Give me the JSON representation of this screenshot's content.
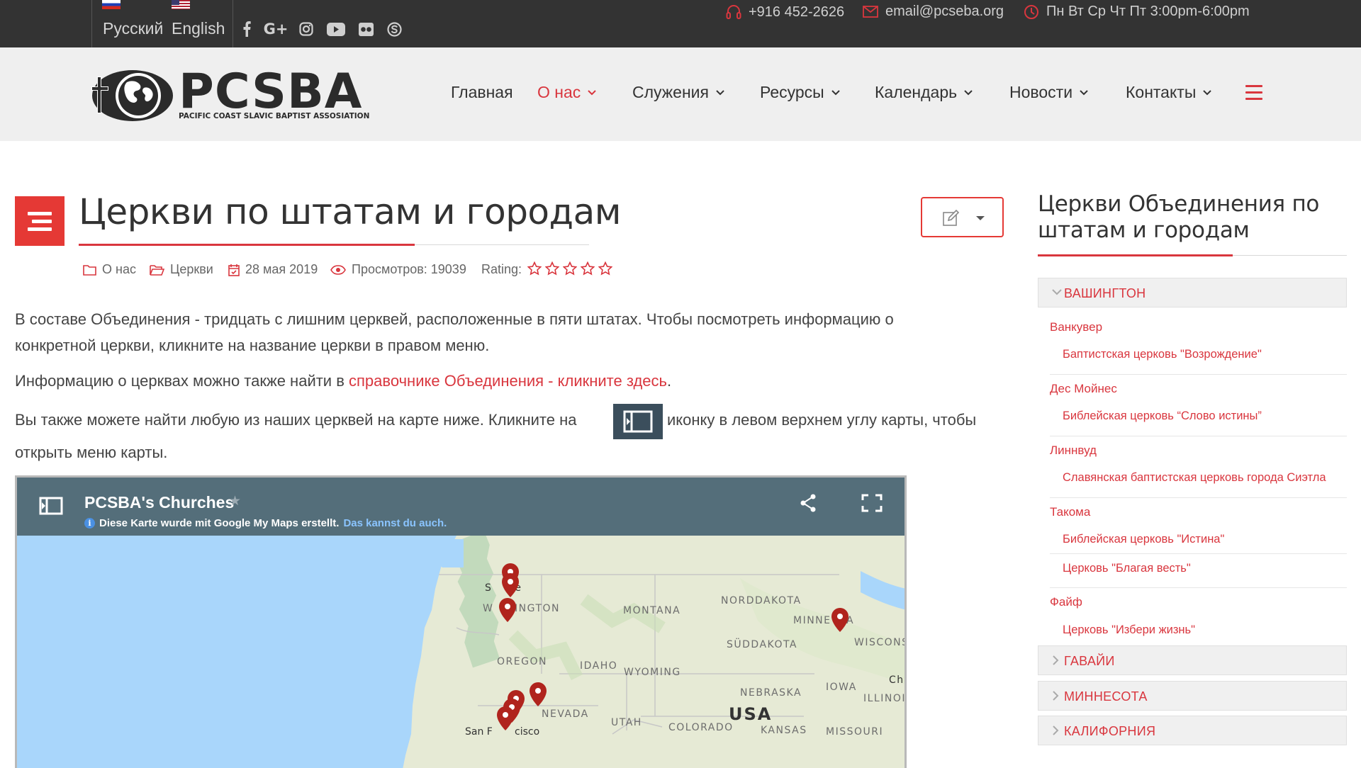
{
  "topbar": {
    "languages": [
      {
        "label": "Русский",
        "flag": "flag-ru-icon"
      },
      {
        "label": "English",
        "flag": "flag-us-icon"
      }
    ],
    "social": [
      "facebook-icon",
      "google-plus-icon",
      "instagram-icon",
      "youtube-icon",
      "flickr-icon",
      "skype-icon"
    ],
    "phone": "+916 452-2626",
    "email": "email@pcseba.org",
    "hours": "Пн Вт Ср Чт Пт 3:00pm-6:00pm"
  },
  "logo": {
    "title": "PCSBA",
    "subtitle": "PACIFIC COAST SLAVIC BAPTIST ASSOSIATION"
  },
  "nav": {
    "items": [
      {
        "label": "Главная"
      },
      {
        "label": "О нас"
      },
      {
        "label": "Служения"
      },
      {
        "label": "Ресурсы"
      },
      {
        "label": "Календарь"
      },
      {
        "label": "Новости"
      },
      {
        "label": "Контакты"
      }
    ],
    "active_index": 1
  },
  "article": {
    "title": "Церкви по штатам и городам",
    "meta": {
      "category": "О нас",
      "subcategory": "Церкви",
      "date": "28 мая 2019",
      "views": "Просмотров: 19039",
      "rating_label": "Rating:",
      "rating_stars": 0,
      "rating_max": 5
    },
    "p1_line1": "В составе Объединения - тридцать с лишним церквей, расположенные в пяти штатах. Чтобы посмотреть информацию о",
    "p1_line2": "конкретной церкви, кликните на название церкви в правом меню.",
    "p2_text": "Информацию о церквах можно также найти в ",
    "p2_link": "справочнике Объединения - кликните здесь",
    "p2_end": ".",
    "p3_text": "Вы также можете найти любую из наших церквей на карте ниже. Кликните на",
    "p3_text_after": "иконку в левом верхнем углу карты, чтобы",
    "p3_line2": "открыть меню карты."
  },
  "map": {
    "title": "PCSBA's Churches",
    "notice": "Diese Karte wurde mit Google My Maps erstellt.",
    "notice_link": "Das kannst du auch.",
    "labels": {
      "seattle_a": "S",
      "seattle_b": "le",
      "washington_a": "W",
      "washington_b": "HINGTON",
      "montana": "MONTANA",
      "north_dakota": "NORDDAKOTA",
      "minnesota_a": "MINNE",
      "minnesota_b": "A",
      "wisconsin": "WISCONS",
      "south_dakota": "SÜDDAKOTA",
      "oregon": "OREGON",
      "idaho": "IDAHO",
      "wyoming": "WYOMING",
      "iowa": "IOWA",
      "chicago": "Chi",
      "nebraska": "NEBRASKA",
      "illinois": "ILLINOI",
      "nevada": "NEVADA",
      "usa": "USA",
      "utah": "UTAH",
      "colorado": "COLORADO",
      "kansas": "KANSAS",
      "missouri": "MISSOURI",
      "san_francisco_a": "San F",
      "san_francisco_b": "cisco"
    },
    "colors": {
      "water": "#a9d6fb",
      "land": "#e6ead5",
      "marker": "#b0241d",
      "header": "#546e7a"
    }
  },
  "sidebar": {
    "title_line1": "Церкви Объединения по",
    "title_line2": "штатам и городам",
    "states": [
      {
        "name": "ВАШИНГТОН",
        "expanded": true,
        "cities": [
          {
            "name": "Ванкувер",
            "churches": [
              "Баптистская церковь \"Возрождение\""
            ]
          },
          {
            "name": "Дес Мойнес",
            "churches": [
              "Библейская церковь “Слово истины”"
            ]
          },
          {
            "name": "Линнвуд",
            "churches": [
              "Славянская баптистская церковь города Сиэтла"
            ]
          },
          {
            "name": "Такома",
            "churches": [
              "Библейская церковь \"Истина\"",
              "Церковь \"Благая весть\""
            ]
          },
          {
            "name": "Файф",
            "churches": [
              "Церковь \"Избери жизнь\""
            ]
          }
        ]
      },
      {
        "name": "ГАВАЙИ",
        "expanded": false
      },
      {
        "name": "МИННЕСОТА",
        "expanded": false
      },
      {
        "name": "КАЛИФОРНИЯ",
        "expanded": false
      }
    ]
  },
  "colors": {
    "accent": "#d9363e",
    "topbar": "#333333",
    "navbar": "#efefef"
  }
}
